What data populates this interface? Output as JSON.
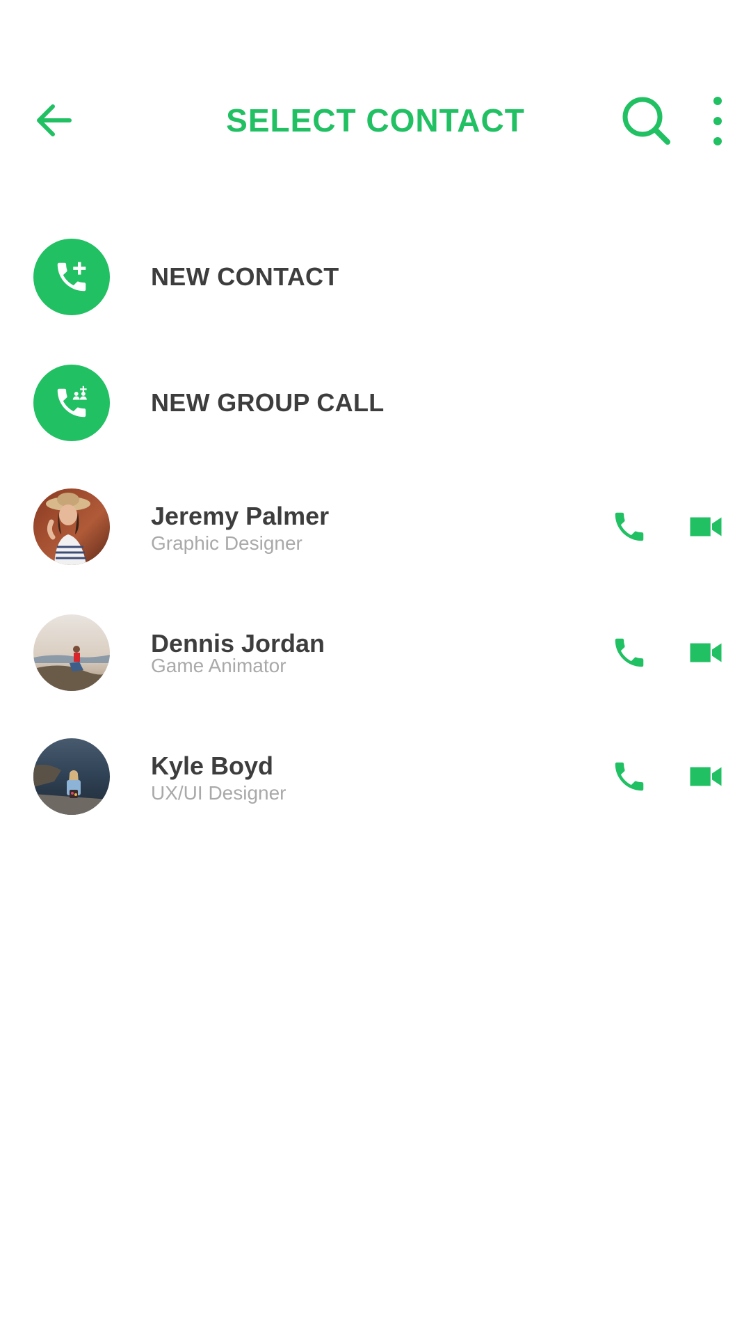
{
  "colors": {
    "accent": "#21c063",
    "text_dark": "#3d3d3d",
    "text_muted": "#a9a9a9",
    "background": "#ffffff"
  },
  "header": {
    "title": "SELECT CONTACT",
    "back_icon": "arrow-left-icon",
    "search_icon": "search-icon",
    "menu_icon": "more-vertical-icon"
  },
  "actions": [
    {
      "label": "NEW CONTACT",
      "icon": "add-call-icon"
    },
    {
      "label": "NEW GROUP CALL",
      "icon": "group-call-icon"
    }
  ],
  "contacts": [
    {
      "name": "Jeremy Palmer",
      "role": "Graphic Designer",
      "avatar": "avatar-photo",
      "call_icon": "phone-icon",
      "video_icon": "video-icon"
    },
    {
      "name": "Dennis Jordan",
      "role": "Game Animator",
      "avatar": "avatar-photo",
      "call_icon": "phone-icon",
      "video_icon": "video-icon"
    },
    {
      "name": "Kyle Boyd",
      "role": "UX/UI Designer",
      "avatar": "avatar-photo",
      "call_icon": "phone-icon",
      "video_icon": "video-icon"
    }
  ]
}
